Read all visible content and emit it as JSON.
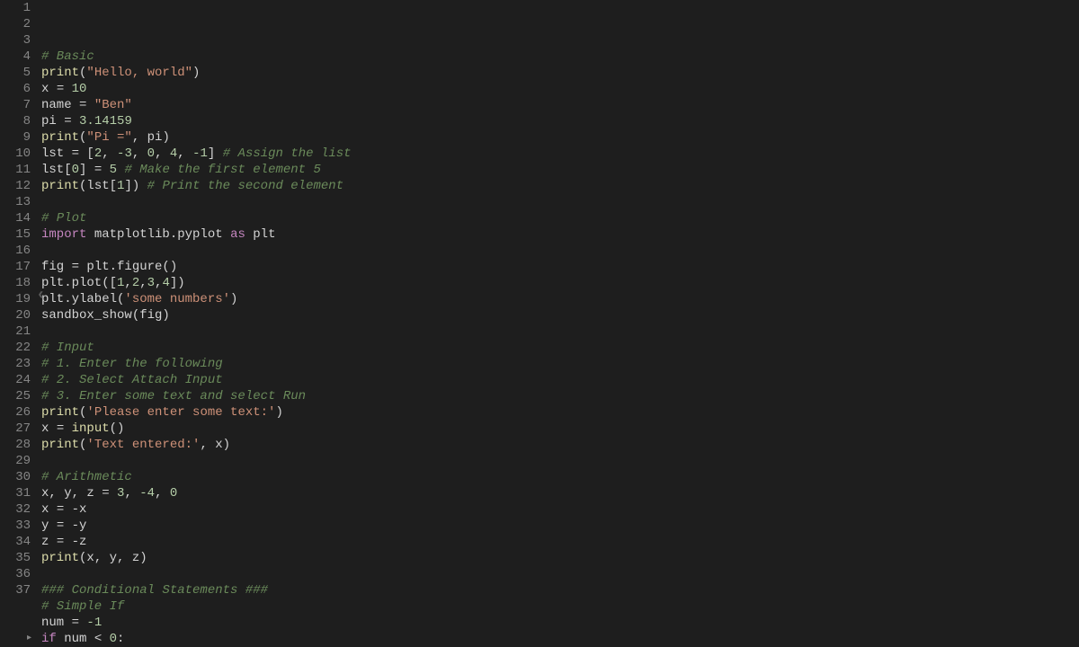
{
  "editor": {
    "gutter_start": 1,
    "gutter_end": 37,
    "partial_line_after": "38",
    "lines": [
      {
        "n": 1,
        "tokens": [
          {
            "t": "# Basic",
            "c": "comment"
          }
        ]
      },
      {
        "n": 2,
        "tokens": [
          {
            "t": "print",
            "c": "builtin"
          },
          {
            "t": "(",
            "c": "punct"
          },
          {
            "t": "\"Hello, world\"",
            "c": "string"
          },
          {
            "t": ")",
            "c": "punct"
          }
        ]
      },
      {
        "n": 3,
        "tokens": [
          {
            "t": "x ",
            "c": "var"
          },
          {
            "t": "=",
            "c": "op"
          },
          {
            "t": " ",
            "c": "var"
          },
          {
            "t": "10",
            "c": "number"
          }
        ]
      },
      {
        "n": 4,
        "tokens": [
          {
            "t": "name ",
            "c": "var"
          },
          {
            "t": "=",
            "c": "op"
          },
          {
            "t": " ",
            "c": "var"
          },
          {
            "t": "\"Ben\"",
            "c": "string"
          }
        ]
      },
      {
        "n": 5,
        "tokens": [
          {
            "t": "pi ",
            "c": "var"
          },
          {
            "t": "=",
            "c": "op"
          },
          {
            "t": " ",
            "c": "var"
          },
          {
            "t": "3.14159",
            "c": "number"
          }
        ]
      },
      {
        "n": 6,
        "tokens": [
          {
            "t": "print",
            "c": "builtin"
          },
          {
            "t": "(",
            "c": "punct"
          },
          {
            "t": "\"Pi =\"",
            "c": "string"
          },
          {
            "t": ", pi)",
            "c": "punct"
          }
        ]
      },
      {
        "n": 7,
        "tokens": [
          {
            "t": "lst ",
            "c": "var"
          },
          {
            "t": "=",
            "c": "op"
          },
          {
            "t": " [",
            "c": "punct"
          },
          {
            "t": "2",
            "c": "number"
          },
          {
            "t": ", ",
            "c": "punct"
          },
          {
            "t": "-3",
            "c": "number"
          },
          {
            "t": ", ",
            "c": "punct"
          },
          {
            "t": "0",
            "c": "number"
          },
          {
            "t": ", ",
            "c": "punct"
          },
          {
            "t": "4",
            "c": "number"
          },
          {
            "t": ", ",
            "c": "punct"
          },
          {
            "t": "-1",
            "c": "number"
          },
          {
            "t": "] ",
            "c": "punct"
          },
          {
            "t": "# Assign the list",
            "c": "comment"
          }
        ]
      },
      {
        "n": 8,
        "tokens": [
          {
            "t": "lst[",
            "c": "var"
          },
          {
            "t": "0",
            "c": "number"
          },
          {
            "t": "] ",
            "c": "punct"
          },
          {
            "t": "=",
            "c": "op"
          },
          {
            "t": " ",
            "c": "var"
          },
          {
            "t": "5",
            "c": "number"
          },
          {
            "t": " ",
            "c": "var"
          },
          {
            "t": "# Make the first element 5",
            "c": "comment"
          }
        ]
      },
      {
        "n": 9,
        "tokens": [
          {
            "t": "print",
            "c": "builtin"
          },
          {
            "t": "(lst[",
            "c": "punct"
          },
          {
            "t": "1",
            "c": "number"
          },
          {
            "t": "]) ",
            "c": "punct"
          },
          {
            "t": "# Print the second element",
            "c": "comment"
          }
        ]
      },
      {
        "n": 10,
        "tokens": [
          {
            "t": "",
            "c": "var"
          }
        ]
      },
      {
        "n": 11,
        "tokens": [
          {
            "t": "# Plot",
            "c": "comment"
          }
        ]
      },
      {
        "n": 12,
        "tokens": [
          {
            "t": "import",
            "c": "keyword"
          },
          {
            "t": " matplotlib.pyplot ",
            "c": "module"
          },
          {
            "t": "as",
            "c": "keyword"
          },
          {
            "t": " plt",
            "c": "module"
          }
        ]
      },
      {
        "n": 13,
        "tokens": [
          {
            "t": "",
            "c": "var"
          }
        ]
      },
      {
        "n": 14,
        "tokens": [
          {
            "t": "fig ",
            "c": "var"
          },
          {
            "t": "=",
            "c": "op"
          },
          {
            "t": " plt.figure()",
            "c": "var"
          }
        ]
      },
      {
        "n": 15,
        "tokens": [
          {
            "t": "plt.plot([",
            "c": "var"
          },
          {
            "t": "1",
            "c": "number"
          },
          {
            "t": ",",
            "c": "punct"
          },
          {
            "t": "2",
            "c": "number"
          },
          {
            "t": ",",
            "c": "punct"
          },
          {
            "t": "3",
            "c": "number"
          },
          {
            "t": ",",
            "c": "punct"
          },
          {
            "t": "4",
            "c": "number"
          },
          {
            "t": "])",
            "c": "punct"
          }
        ]
      },
      {
        "n": 16,
        "tokens": [
          {
            "t": "plt.ylabel(",
            "c": "var"
          },
          {
            "t": "'some numbers'",
            "c": "string"
          },
          {
            "t": ")",
            "c": "punct"
          }
        ]
      },
      {
        "n": 17,
        "tokens": [
          {
            "t": "sandbox_show(fig)",
            "c": "var"
          }
        ]
      },
      {
        "n": 18,
        "tokens": [
          {
            "t": "",
            "c": "var"
          }
        ]
      },
      {
        "n": 19,
        "tokens": [
          {
            "t": "# Input",
            "c": "comment"
          }
        ]
      },
      {
        "n": 20,
        "tokens": [
          {
            "t": "# 1. Enter the following",
            "c": "comment"
          }
        ]
      },
      {
        "n": 21,
        "tokens": [
          {
            "t": "# 2. Select Attach Input",
            "c": "comment"
          }
        ]
      },
      {
        "n": 22,
        "tokens": [
          {
            "t": "# 3. Enter some text and select Run",
            "c": "comment"
          }
        ]
      },
      {
        "n": 23,
        "tokens": [
          {
            "t": "print",
            "c": "builtin"
          },
          {
            "t": "(",
            "c": "punct"
          },
          {
            "t": "'Please enter some text:'",
            "c": "string"
          },
          {
            "t": ")",
            "c": "punct"
          }
        ]
      },
      {
        "n": 24,
        "tokens": [
          {
            "t": "x ",
            "c": "var"
          },
          {
            "t": "=",
            "c": "op"
          },
          {
            "t": " ",
            "c": "var"
          },
          {
            "t": "input",
            "c": "builtin"
          },
          {
            "t": "()",
            "c": "punct"
          }
        ]
      },
      {
        "n": 25,
        "tokens": [
          {
            "t": "print",
            "c": "builtin"
          },
          {
            "t": "(",
            "c": "punct"
          },
          {
            "t": "'Text entered:'",
            "c": "string"
          },
          {
            "t": ", x)",
            "c": "punct"
          }
        ]
      },
      {
        "n": 26,
        "tokens": [
          {
            "t": "",
            "c": "var"
          }
        ]
      },
      {
        "n": 27,
        "tokens": [
          {
            "t": "# Arithmetic",
            "c": "comment"
          }
        ]
      },
      {
        "n": 28,
        "tokens": [
          {
            "t": "x, y, z ",
            "c": "var"
          },
          {
            "t": "=",
            "c": "op"
          },
          {
            "t": " ",
            "c": "var"
          },
          {
            "t": "3",
            "c": "number"
          },
          {
            "t": ", ",
            "c": "punct"
          },
          {
            "t": "-4",
            "c": "number"
          },
          {
            "t": ", ",
            "c": "punct"
          },
          {
            "t": "0",
            "c": "number"
          }
        ]
      },
      {
        "n": 29,
        "tokens": [
          {
            "t": "x ",
            "c": "var"
          },
          {
            "t": "=",
            "c": "op"
          },
          {
            "t": " -x",
            "c": "var"
          }
        ]
      },
      {
        "n": 30,
        "tokens": [
          {
            "t": "y ",
            "c": "var"
          },
          {
            "t": "=",
            "c": "op"
          },
          {
            "t": " -y",
            "c": "var"
          }
        ]
      },
      {
        "n": 31,
        "tokens": [
          {
            "t": "z ",
            "c": "var"
          },
          {
            "t": "=",
            "c": "op"
          },
          {
            "t": " -z",
            "c": "var"
          }
        ]
      },
      {
        "n": 32,
        "tokens": [
          {
            "t": "print",
            "c": "builtin"
          },
          {
            "t": "(x, y, z)",
            "c": "punct"
          }
        ]
      },
      {
        "n": 33,
        "tokens": [
          {
            "t": "",
            "c": "var"
          }
        ]
      },
      {
        "n": 34,
        "tokens": [
          {
            "t": "### Conditional Statements ###",
            "c": "comment"
          }
        ]
      },
      {
        "n": 35,
        "tokens": [
          {
            "t": "# Simple If",
            "c": "comment"
          }
        ]
      },
      {
        "n": 36,
        "tokens": [
          {
            "t": "num ",
            "c": "var"
          },
          {
            "t": "=",
            "c": "op"
          },
          {
            "t": " ",
            "c": "var"
          },
          {
            "t": "-1",
            "c": "number"
          }
        ]
      },
      {
        "n": 37,
        "fold": true,
        "tokens": [
          {
            "t": "if",
            "c": "keyword"
          },
          {
            "t": " num ",
            "c": "var"
          },
          {
            "t": "<",
            "c": "op"
          },
          {
            "t": " ",
            "c": "var"
          },
          {
            "t": "0",
            "c": "number"
          },
          {
            "t": ":",
            "c": "punct"
          }
        ]
      }
    ],
    "chevron_label": "‹"
  }
}
